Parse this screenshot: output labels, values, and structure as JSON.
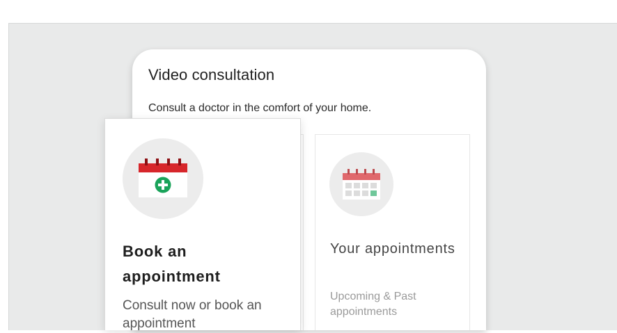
{
  "panel": {
    "title": "Video consultation",
    "subtitle": "Consult a doctor in the comfort of your home."
  },
  "cards": [
    {
      "title": "Book an appointment",
      "description": "Consult now or book an appointment",
      "icon": "calendar-plus-icon"
    },
    {
      "title": "Your appointments",
      "description": "Upcoming & Past appointments",
      "icon": "calendar-grid-icon"
    }
  ],
  "colors": {
    "calendar_red": "#d7262b",
    "plus_green": "#1aa35a",
    "icon_circle_bg": "#ececec",
    "stage_bg": "#e9eaea"
  }
}
